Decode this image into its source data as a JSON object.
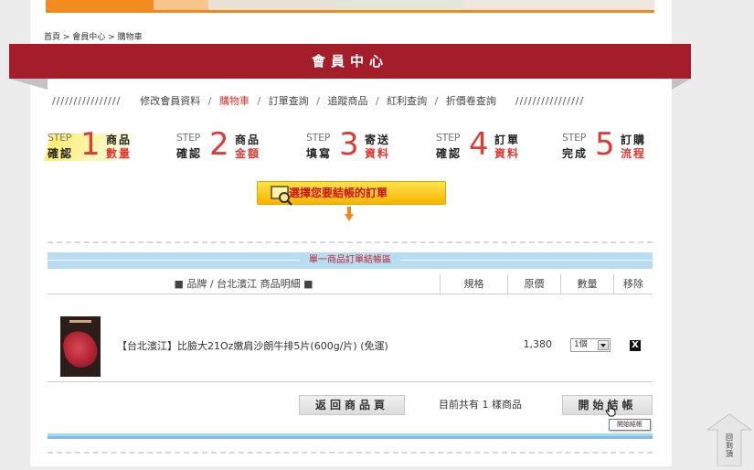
{
  "breadcrumb": {
    "home": "首頁",
    "sep1": " > ",
    "member": "會員中心",
    "sep2": " > ",
    "cart": "購物車"
  },
  "title": "會員中心",
  "nav": {
    "slashes_left": "////////////////",
    "slashes_right": "////////////////",
    "items": [
      "修改會員資料",
      "購物車",
      "訂單查詢",
      "追蹤商品",
      "紅利查詢",
      "折價卷查詢"
    ],
    "active_index": 1,
    "separator": "/"
  },
  "steps": [
    {
      "word": "STEP",
      "num": "1",
      "l1": "確認",
      "r1": "商品",
      "r2": "數量"
    },
    {
      "word": "STEP",
      "num": "2",
      "l1": "確認",
      "r1": "商品",
      "r2": "金額"
    },
    {
      "word": "STEP",
      "num": "3",
      "l1": "填寫",
      "r1": "寄送",
      "r2": "資料"
    },
    {
      "word": "STEP",
      "num": "4",
      "l1": "確認",
      "r1": "訂單",
      "r2": "資料"
    },
    {
      "word": "STEP",
      "num": "5",
      "l1": "完成",
      "r1": "訂購",
      "r2": "流程"
    }
  ],
  "choose_banner": "選擇您要結帳的訂單",
  "zone_label": "單一商品訂單結帳區",
  "table": {
    "headers": {
      "name": "■ 品牌 / 台北濱江 商品明細 ■",
      "spec": "規格",
      "price": "原價",
      "qty": "數量",
      "remove": "移除"
    },
    "rows": [
      {
        "name": "【台北濱江】比臉大21Oz嫩肩沙朗牛排5片(600g/片) (免運)",
        "spec": "",
        "price": "1,380",
        "qty": "1個",
        "remove": "X"
      }
    ]
  },
  "actions": {
    "back_label": "返回商品頁",
    "summary": "目前共有 1 樣商品",
    "checkout_label": "開始結帳",
    "checkout_tooltip": "開始結帳"
  },
  "back_to_top": "回到頂",
  "colors": {
    "title_bar": "#a31d2b",
    "accent_red": "#e03a35",
    "zone_blue": "#b8dcf0",
    "banner_yellow": "#f6b400"
  }
}
